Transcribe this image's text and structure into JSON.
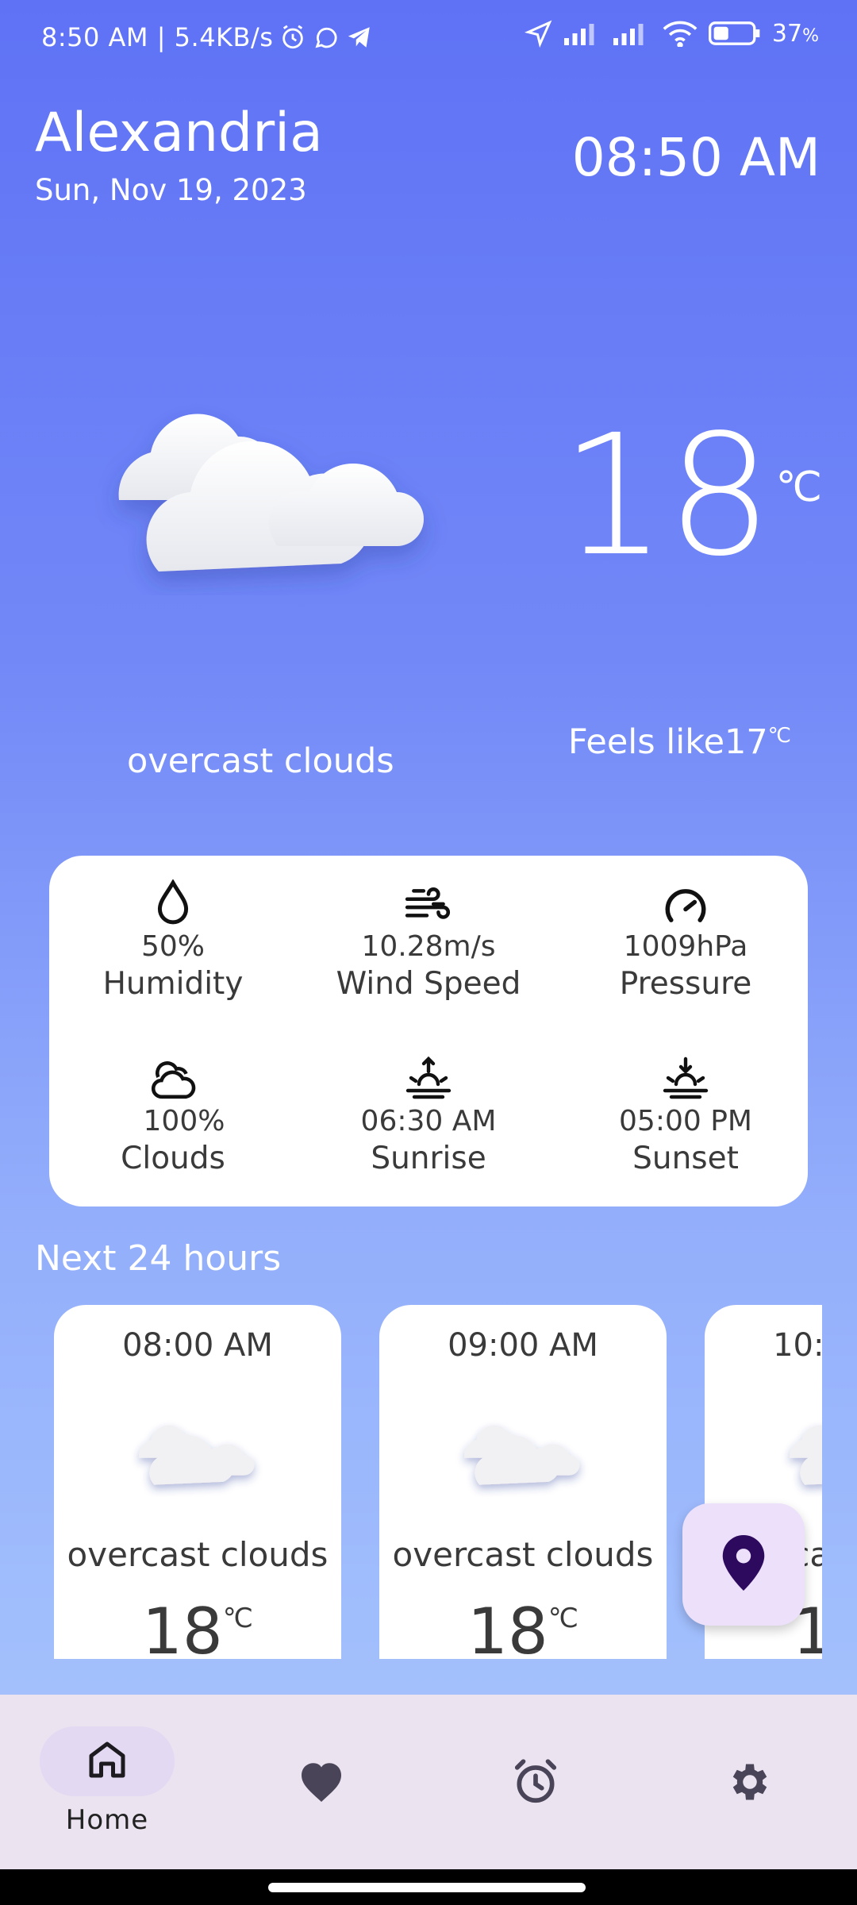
{
  "status_bar": {
    "left_text": "8:50 AM | 5.4KB/s",
    "battery": "37",
    "battery_unit": "%",
    "icons": [
      "alarm-icon",
      "whatsapp-icon",
      "telegram-icon",
      "location-arrow-icon",
      "signal-icon",
      "signal-icon",
      "wifi-icon",
      "battery-icon"
    ]
  },
  "header": {
    "city": "Alexandria",
    "date": "Sun, Nov 19, 2023",
    "time": "08:50 AM"
  },
  "current": {
    "temp": "18",
    "unit": "℃",
    "description": "overcast clouds",
    "feels_like_label": "Feels like17",
    "feels_unit": "℃",
    "icon": "cloud-icon"
  },
  "details": [
    {
      "value": "50%",
      "label": "Humidity",
      "icon": "droplet-icon"
    },
    {
      "value": "10.28m/s",
      "label": "Wind Speed",
      "icon": "wind-icon"
    },
    {
      "value": "1009hPa",
      "label": "Pressure",
      "icon": "gauge-icon"
    },
    {
      "value": "100%",
      "label": "Clouds",
      "icon": "clouds-icon"
    },
    {
      "value": "06:30 AM",
      "label": "Sunrise",
      "icon": "sunrise-icon"
    },
    {
      "value": "05:00 PM",
      "label": "Sunset",
      "icon": "sunset-icon"
    }
  ],
  "hourly": {
    "title": "Next 24 hours",
    "items": [
      {
        "time": "08:00 AM",
        "desc": "overcast clouds",
        "temp": "18",
        "unit": "℃"
      },
      {
        "time": "09:00 AM",
        "desc": "overcast clouds",
        "temp": "18",
        "unit": "℃"
      },
      {
        "time": "10:00 AM",
        "desc": "overcast clouds",
        "temp": "18",
        "unit": "℃"
      }
    ]
  },
  "fab": {
    "icon": "map-pin-icon"
  },
  "nav": {
    "items": [
      {
        "label": "Home",
        "icon": "home-icon",
        "active": true
      },
      {
        "label": "",
        "icon": "heart-icon",
        "active": false
      },
      {
        "label": "",
        "icon": "alarm-clock-icon",
        "active": false
      },
      {
        "label": "",
        "icon": "gear-icon",
        "active": false
      }
    ]
  },
  "colors": {
    "accent": "#5f72f6",
    "fab_bg": "#ece0fa",
    "pin": "#2d0a5e",
    "nav_bg": "#ebe3ef"
  }
}
